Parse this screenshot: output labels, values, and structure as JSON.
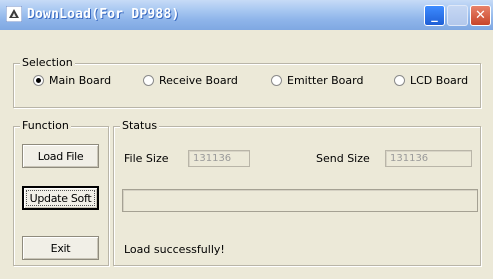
{
  "window": {
    "title": "DownLoad(For DP988)"
  },
  "selection": {
    "legend": "Selection",
    "options": [
      {
        "label": "Main Board",
        "checked": true
      },
      {
        "label": "Receive Board",
        "checked": false
      },
      {
        "label": "Emitter Board",
        "checked": false
      },
      {
        "label": "LCD Board",
        "checked": false
      }
    ]
  },
  "function": {
    "legend": "Function",
    "load_label": "Load File",
    "update_label": "Update Soft",
    "exit_label": "Exit"
  },
  "status": {
    "legend": "Status",
    "file_size_label": "File Size",
    "file_size_value": "131136",
    "send_size_label": "Send Size",
    "send_size_value": "131136",
    "progress_fraction": 0,
    "message": "Load successfully!"
  },
  "colors": {
    "titlebar": "#8fb5ea",
    "dialog": "#ece9d8",
    "field_text": "#9a9a9a"
  },
  "icons": [
    "app-icon",
    "minimize-icon",
    "maximize-icon",
    "close-icon"
  ]
}
